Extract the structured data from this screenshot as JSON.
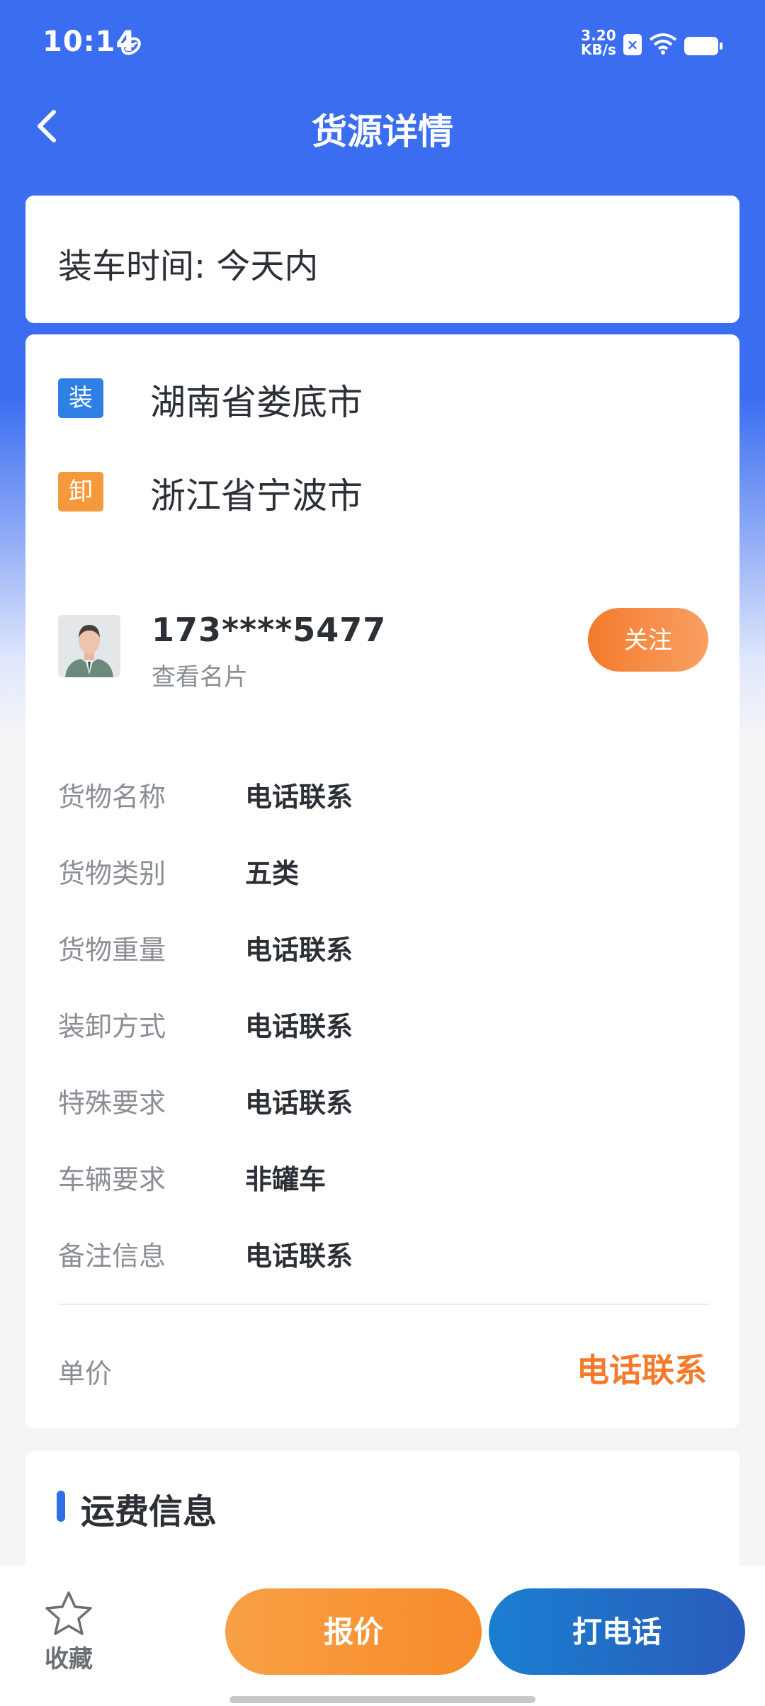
{
  "status_bar": {
    "time": "10:14",
    "net_speed_value": "3.20",
    "net_speed_unit": "KB/s"
  },
  "header": {
    "title": "货源详情"
  },
  "load_time": {
    "text": "装车时间: 今天内"
  },
  "route": {
    "load_badge": "装",
    "load_location": "湖南省娄底市",
    "unload_badge": "卸",
    "unload_location": "浙江省宁波市"
  },
  "contact": {
    "phone": "173****5477",
    "card_link": "查看名片",
    "follow_label": "关注"
  },
  "details": [
    {
      "label": "货物名称",
      "value": "电话联系"
    },
    {
      "label": "货物类别",
      "value": "五类"
    },
    {
      "label": "货物重量",
      "value": "电话联系"
    },
    {
      "label": "装卸方式",
      "value": "电话联系"
    },
    {
      "label": "特殊要求",
      "value": "电话联系"
    },
    {
      "label": "车辆要求",
      "value": "非罐车"
    },
    {
      "label": "备注信息",
      "value": "电话联系"
    }
  ],
  "price": {
    "label": "单价",
    "value": "电话联系"
  },
  "freight": {
    "title": "运费信息"
  },
  "bottom_bar": {
    "favorite_label": "收藏",
    "quote_label": "报价",
    "call_label": "打电话"
  },
  "colors": {
    "primary_blue": "#3a6df0",
    "accent_orange": "#f47a2c",
    "load_badge": "#2f7fe6",
    "unload_badge": "#f59a3c"
  },
  "icons": {
    "back": "chevron-left-icon",
    "favorite": "star-outline-icon",
    "wifi": "wifi-icon",
    "battery": "battery-icon"
  }
}
